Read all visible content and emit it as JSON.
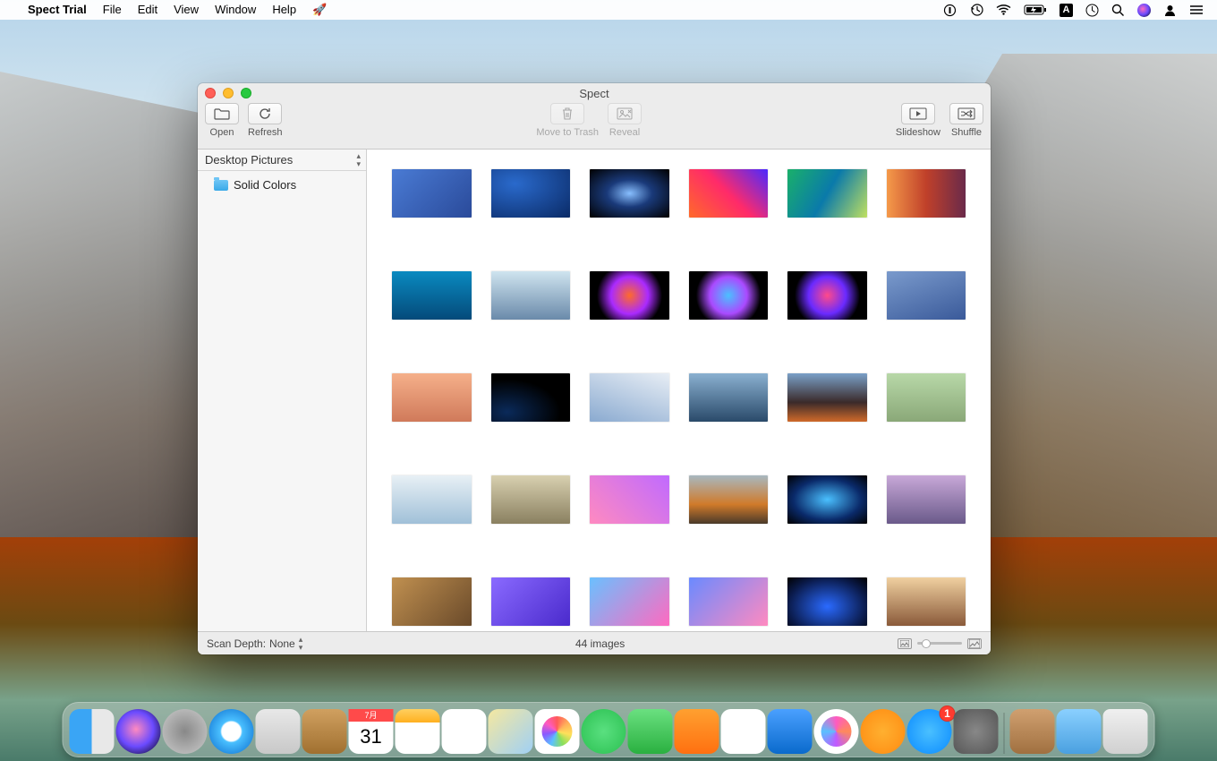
{
  "menubar": {
    "app": "Spect Trial",
    "items": [
      "File",
      "Edit",
      "View",
      "Window",
      "Help"
    ]
  },
  "window": {
    "title": "Spect",
    "toolbar": {
      "open": "Open",
      "refresh": "Refresh",
      "trash": "Move to Trash",
      "reveal": "Reveal",
      "slideshow": "Slideshow",
      "shuffle": "Shuffle"
    },
    "sidebar": {
      "source": "Desktop Pictures",
      "items": [
        "Solid Colors"
      ]
    },
    "status": {
      "scan_depth_label": "Scan Depth:",
      "scan_depth_value": "None",
      "count": "44 images"
    }
  },
  "dock": {
    "appstore_badge": "1"
  },
  "thumbs": [
    [
      "linear-gradient(135deg,#4a7bd4,#2a4a9a)",
      "radial-gradient(ellipse at 30% 30%,#2a6acc,#0a2a66)",
      "radial-gradient(ellipse at 50% 50%,#88bfff 0%,#1a3a7a 40%,#000 100%)",
      "linear-gradient(45deg,#ff6a2a,#ff2a6a,#4a2aff)",
      "linear-gradient(120deg,#1ab06a,#0a7aaa,#c0e060)",
      "linear-gradient(90deg,#f59a4a,#c0402a,#6a2a4a)"
    ],
    [
      "linear-gradient(180deg,#0a8ac0,#044a7a)",
      "linear-gradient(180deg,#cfe4ef,#6a8aaa)",
      "radial-gradient(circle at 50% 50%,#ff6a2a,#aa2aff 40%,#000 70%)",
      "radial-gradient(circle at 50% 50%,#4ac0ff,#aa4aff 40%,#000 70%)",
      "radial-gradient(circle at 50% 50%,#ff4a8a,#6a2aff 40%,#000 70%)",
      "linear-gradient(160deg,#7a9acc,#3a5a9a)"
    ],
    [
      "linear-gradient(180deg,#f5b08a,#d07a5a)",
      "radial-gradient(ellipse at 20% 80%,#0a2a5a,#000 60%)",
      "linear-gradient(200deg,#e8eef5,#8aaad0)",
      "linear-gradient(180deg,#8ab0d0,#2a4a6a)",
      "linear-gradient(180deg,#7aa0c8,#3a2a2a 60%,#d06a2a)",
      "linear-gradient(180deg,#b8d8a8,#8aa878)"
    ],
    [
      "linear-gradient(180deg,#e8f0f5,#a0c0d8)",
      "linear-gradient(180deg,#d8d0b0,#8a8060)",
      "linear-gradient(45deg,#ff8ac0,#c06aff)",
      "linear-gradient(180deg,#a8b8c0,#d07a2a 60%,#4a3a2a)",
      "radial-gradient(ellipse at 50% 50%,#4ac0ff,#0a2a6a 60%,#000)",
      "linear-gradient(180deg,#c8a8d8,#6a5a8a)"
    ],
    [
      "linear-gradient(135deg,#c09050,#6a4a2a)",
      "linear-gradient(135deg,#8a6aff,#4a2acc)",
      "linear-gradient(135deg,#6ac0ff,#ff6ac0)",
      "linear-gradient(135deg,#6a8aff,#ff8ac0)",
      "radial-gradient(ellipse at 50% 60%,#2a6aff,#0a1a4a 70%,#000)",
      "linear-gradient(180deg,#f0d0a0,#8a5a3a)"
    ]
  ]
}
